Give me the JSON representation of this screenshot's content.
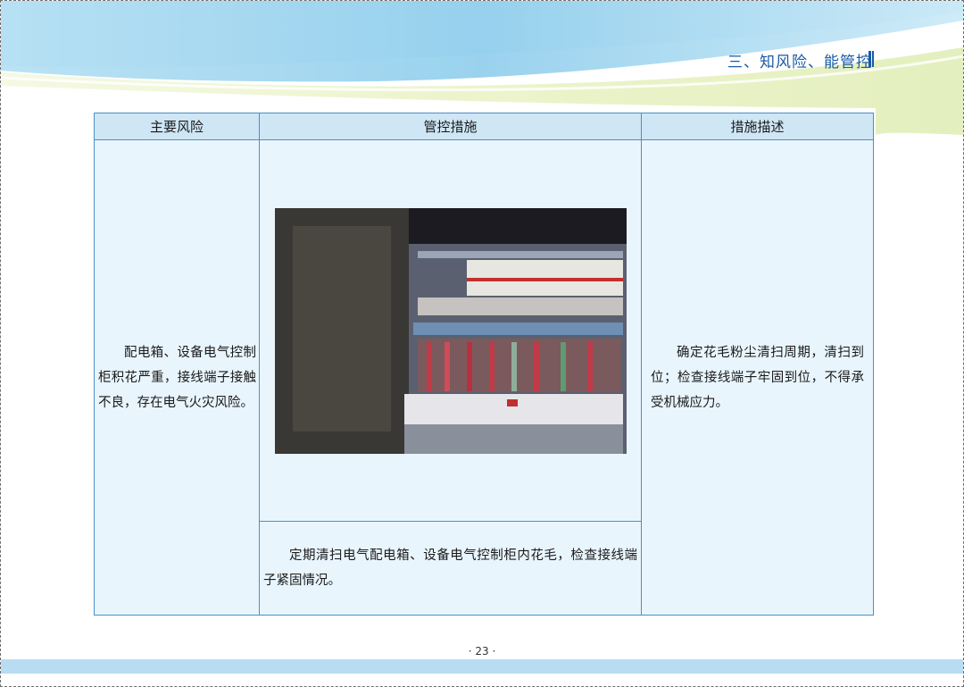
{
  "header": {
    "section_title": "三、知风险、能管控"
  },
  "table": {
    "headers": [
      "主要风险",
      "管控措施",
      "措施描述"
    ],
    "main_risk": "配电箱、设备电气控制柜积花严重，接线端子接触不良，存在电气火灾风险。",
    "control_measure": "定期清扫电气配电箱、设备电气控制柜内花毛，检查接线端子紧固情况。",
    "measure_description": "确定花毛粉尘清扫周期，清扫到位；检查接线端子牢固到位，不得承受机械应力。"
  },
  "page_number": "· 23 ·",
  "colors": {
    "accent": "#1a5aa8",
    "table_border": "#4a90c4",
    "header_bg": "#cfe6f5",
    "cell_bg": "#e9f5fd",
    "swoosh_blue": "#8ccbeb",
    "swoosh_green": "#eef5cf"
  }
}
